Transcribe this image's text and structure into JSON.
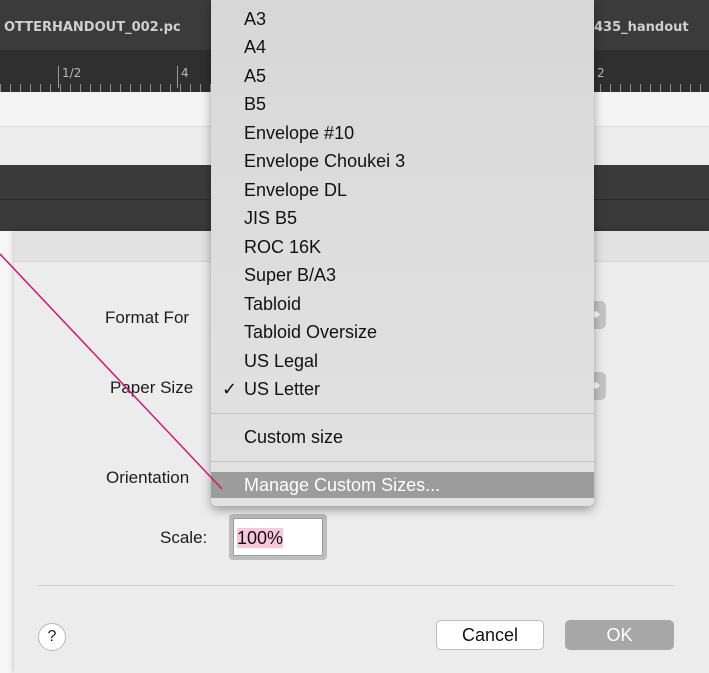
{
  "tabs": {
    "left_tab": "OTTERHANDOUT_002.pc",
    "right_tab": "435_handout"
  },
  "ruler": {
    "labels": [
      "1/2",
      "4",
      "2"
    ]
  },
  "dialog": {
    "format_for_label": "Format For",
    "paper_size_label": "Paper Size",
    "orientation_label": "Orientation",
    "scale_label": "Scale:",
    "scale_value": "100%",
    "help_label": "?",
    "cancel_label": "Cancel",
    "ok_label": "OK"
  },
  "paper_size_menu": {
    "items": [
      "A3",
      "A4",
      "A5",
      "B5",
      "Envelope #10",
      "Envelope Choukei 3",
      "Envelope DL",
      "JIS B5",
      "ROC 16K",
      "Super B/A3",
      "Tabloid",
      "Tabloid Oversize",
      "US Legal",
      "US Letter"
    ],
    "selected": "US Letter",
    "check_mark": "✓",
    "custom_size": "Custom size",
    "manage_custom_sizes": "Manage Custom Sizes..."
  },
  "colors": {
    "menu_highlight": "#9c9c9c",
    "annotation_line": "#d4147a",
    "scale_selection": "#f7c8dc"
  }
}
